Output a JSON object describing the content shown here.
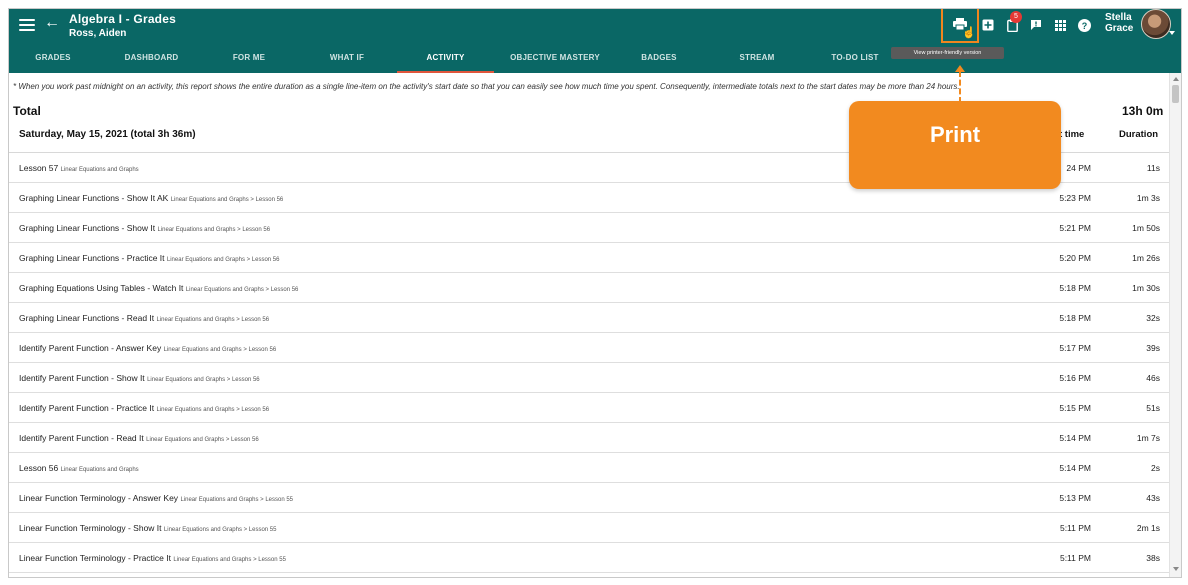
{
  "header": {
    "title": "Algebra I - Grades",
    "student": "Ross, Aiden",
    "user_first": "Stella",
    "user_last": "Grace",
    "notification_count": "5",
    "accent_color": "#0a6765",
    "tooltip": "View printer-friendly version"
  },
  "tabs": [
    {
      "label": "GRADES"
    },
    {
      "label": "DASHBOARD"
    },
    {
      "label": "FOR ME"
    },
    {
      "label": "WHAT IF"
    },
    {
      "label": "ACTIVITY",
      "active": true
    },
    {
      "label": "OBJECTIVE MASTERY"
    },
    {
      "label": "BADGES"
    },
    {
      "label": "STREAM"
    },
    {
      "label": "TO-DO LIST"
    }
  ],
  "content": {
    "note": "* When you work past midnight on an activity, this report shows the entire duration as a single line-item on the activity's start date so that you can easily see how much time you spent. Consequently, intermediate totals next to the start dates may be more than 24 hours.",
    "total_label": "Total",
    "total_value": "13h 0m",
    "day_label": "Saturday, May 15, 2021 (total 3h 36m)",
    "col_start": "t time",
    "col_duration": "Duration",
    "rows": [
      {
        "title": "Lesson 57",
        "meta": "Linear Equations and Graphs",
        "start": "24 PM",
        "dur": "11s"
      },
      {
        "title": "Graphing Linear Functions - Show It AK",
        "meta": "Linear Equations and Graphs > Lesson 56",
        "start": "5:23 PM",
        "dur": "1m 3s"
      },
      {
        "title": "Graphing Linear Functions - Show It",
        "meta": "Linear Equations and Graphs > Lesson 56",
        "start": "5:21 PM",
        "dur": "1m 50s"
      },
      {
        "title": "Graphing Linear Functions - Practice It",
        "meta": "Linear Equations and Graphs > Lesson 56",
        "start": "5:20 PM",
        "dur": "1m 26s"
      },
      {
        "title": "Graphing Equations Using Tables - Watch It",
        "meta": "Linear Equations and Graphs > Lesson 56",
        "start": "5:18 PM",
        "dur": "1m 30s"
      },
      {
        "title": "Graphing Linear Functions - Read It",
        "meta": "Linear Equations and Graphs > Lesson 56",
        "start": "5:18 PM",
        "dur": "32s"
      },
      {
        "title": "Identify Parent Function - Answer Key",
        "meta": "Linear Equations and Graphs > Lesson 56",
        "start": "5:17 PM",
        "dur": "39s"
      },
      {
        "title": "Identify Parent Function - Show It",
        "meta": "Linear Equations and Graphs > Lesson 56",
        "start": "5:16 PM",
        "dur": "46s"
      },
      {
        "title": "Identify Parent Function - Practice It",
        "meta": "Linear Equations and Graphs > Lesson 56",
        "start": "5:15 PM",
        "dur": "51s"
      },
      {
        "title": "Identify Parent Function - Read It",
        "meta": "Linear Equations and Graphs > Lesson 56",
        "start": "5:14 PM",
        "dur": "1m 7s"
      },
      {
        "title": "Lesson 56",
        "meta": "Linear Equations and Graphs",
        "start": "5:14 PM",
        "dur": "2s"
      },
      {
        "title": "Linear Function Terminology - Answer Key",
        "meta": "Linear Equations and Graphs > Lesson 55",
        "start": "5:13 PM",
        "dur": "43s"
      },
      {
        "title": "Linear Function Terminology - Show It",
        "meta": "Linear Equations and Graphs > Lesson 55",
        "start": "5:11 PM",
        "dur": "2m 1s"
      },
      {
        "title": "Linear Function Terminology - Practice It",
        "meta": "Linear Equations and Graphs > Lesson 55",
        "start": "5:11 PM",
        "dur": "38s"
      }
    ]
  },
  "callout": {
    "label": "Print",
    "color": "#f28a1f"
  }
}
